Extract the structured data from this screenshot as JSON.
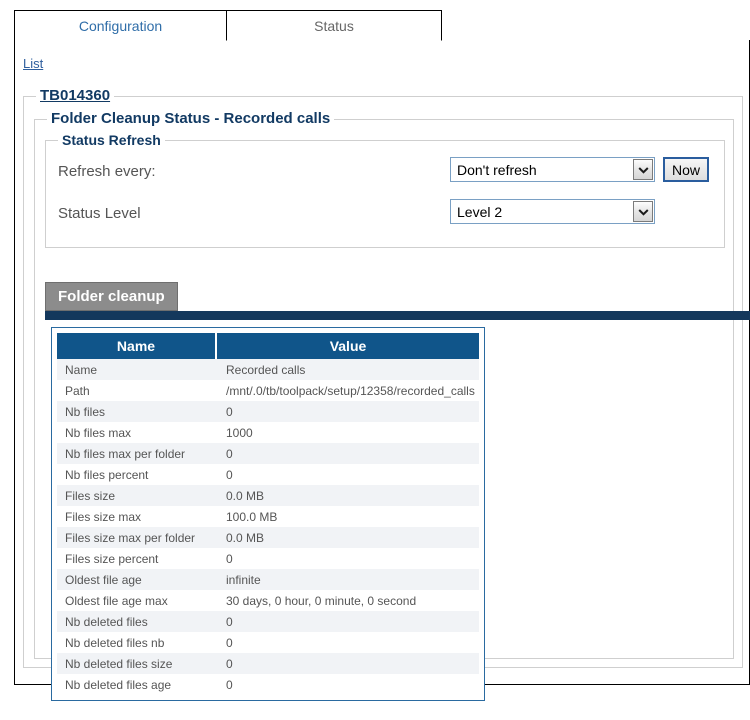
{
  "tabs": [
    {
      "label": "Configuration",
      "active": false
    },
    {
      "label": "Status",
      "active": true
    }
  ],
  "breadcrumb": {
    "list_link": "List"
  },
  "fieldsets": {
    "device_legend": "TB014360",
    "section_legend": "Folder Cleanup Status - Recorded calls",
    "refresh_legend": "Status Refresh"
  },
  "form": {
    "refresh_every_label": "Refresh every:",
    "refresh_every_value": "Don't refresh",
    "now_button": "Now",
    "status_level_label": "Status Level",
    "status_level_value": "Level 2"
  },
  "inner_tab": {
    "label": "Folder cleanup"
  },
  "table": {
    "columns": [
      "Name",
      "Value"
    ],
    "rows": [
      {
        "name": "Name",
        "value": "Recorded calls"
      },
      {
        "name": "Path",
        "value": "/mnt/.0/tb/toolpack/setup/12358/recorded_calls"
      },
      {
        "name": "Nb files",
        "value": "0"
      },
      {
        "name": "Nb files max",
        "value": "1000"
      },
      {
        "name": "Nb files max per folder",
        "value": "0"
      },
      {
        "name": "Nb files percent",
        "value": "0"
      },
      {
        "name": "Files size",
        "value": "0.0 MB"
      },
      {
        "name": "Files size max",
        "value": "100.0 MB"
      },
      {
        "name": "Files size max per folder",
        "value": "0.0 MB"
      },
      {
        "name": "Files size percent",
        "value": "0"
      },
      {
        "name": "Oldest file age",
        "value": "infinite"
      },
      {
        "name": "Oldest file age max",
        "value": "30 days, 0 hour, 0 minute, 0 second"
      },
      {
        "name": "Nb deleted files",
        "value": "0"
      },
      {
        "name": "Nb deleted files nb",
        "value": "0"
      },
      {
        "name": "Nb deleted files size",
        "value": "0"
      },
      {
        "name": "Nb deleted files age",
        "value": "0"
      }
    ]
  },
  "colors": {
    "table_header": "#10558a",
    "tab_bar": "#14385c",
    "legend_text": "#123a63",
    "link": "#2f5f9e",
    "inner_tab": "#8c8c8c"
  }
}
